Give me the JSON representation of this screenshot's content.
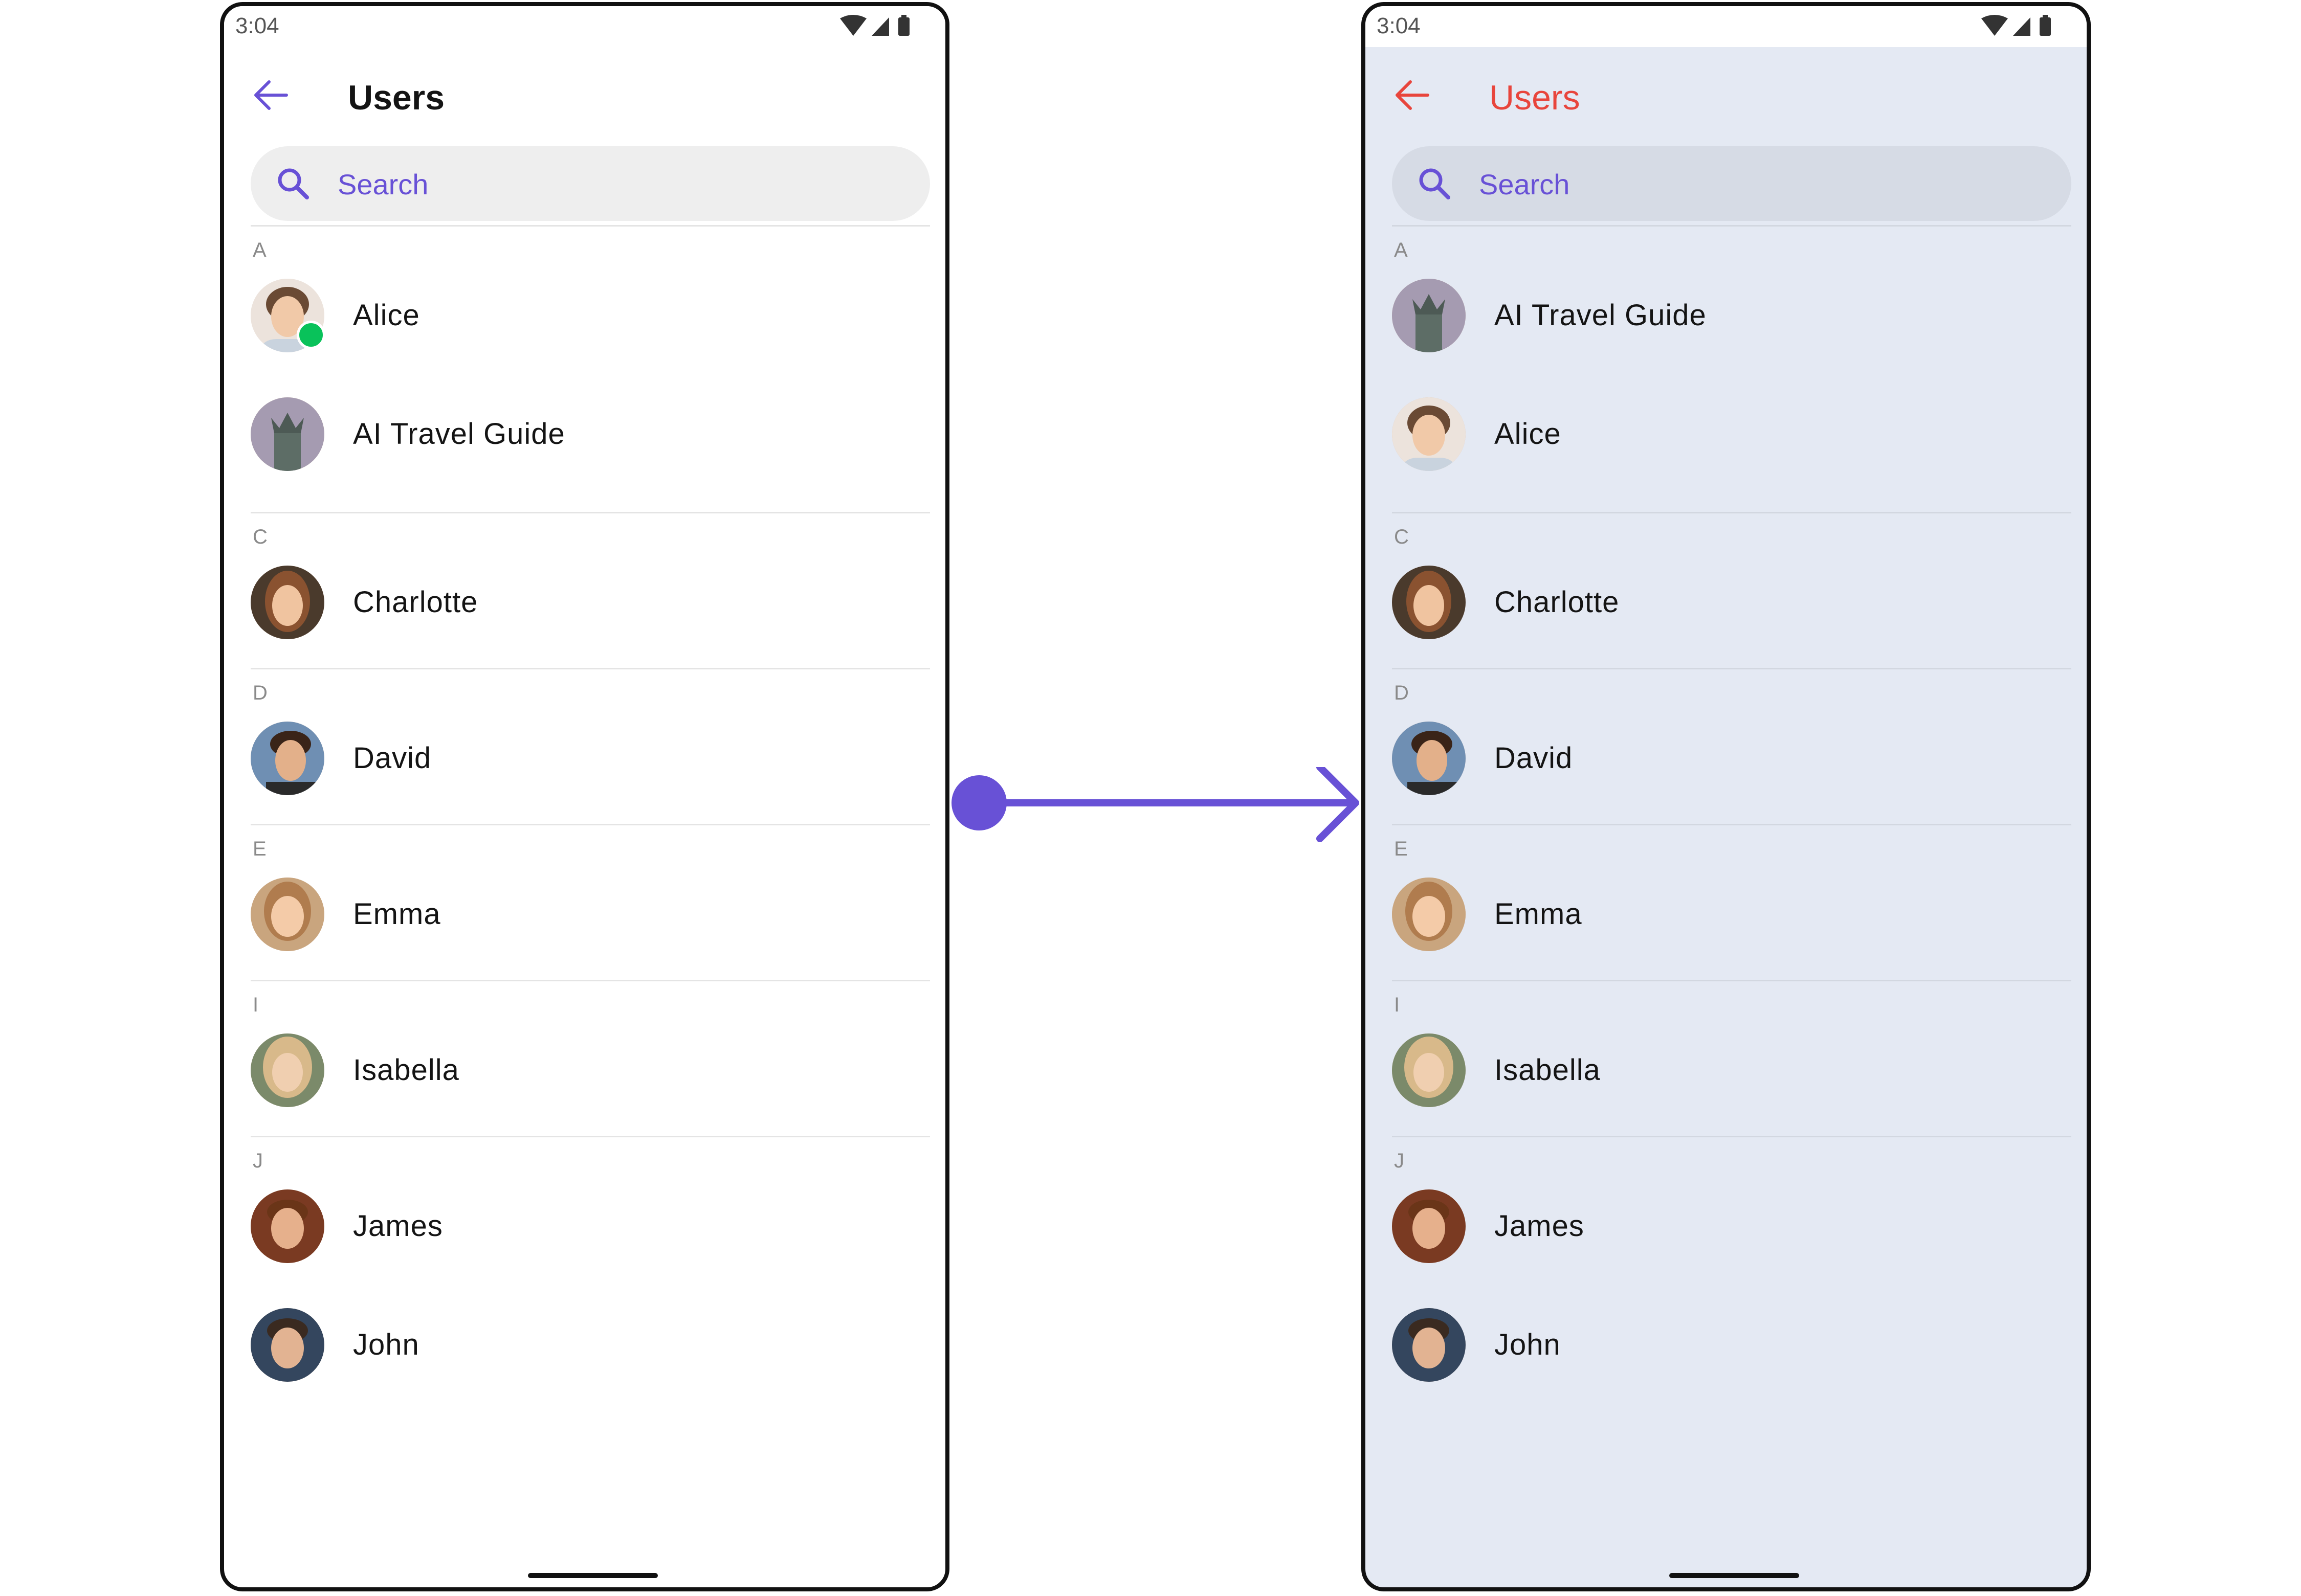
{
  "colors": {
    "accent": "#6851d6",
    "online": "#09c25a",
    "custom_title": "#e8453c",
    "custom_background": "#e4e9f3"
  },
  "icons": {
    "back": "arrow-left-icon",
    "search": "search-icon",
    "status": [
      "wifi-icon",
      "cellular-signal-icon",
      "battery-icon"
    ],
    "transition": "arrow-right-icon"
  },
  "left": {
    "status_time": "3:04",
    "title": "Users",
    "search_placeholder": "Search",
    "sections": [
      {
        "letter": "A",
        "users": [
          {
            "name": "Alice",
            "online": true
          },
          {
            "name": "AI Travel Guide",
            "online": false
          }
        ]
      },
      {
        "letter": "C",
        "users": [
          {
            "name": "Charlotte",
            "online": false
          }
        ]
      },
      {
        "letter": "D",
        "users": [
          {
            "name": "David",
            "online": false
          }
        ]
      },
      {
        "letter": "E",
        "users": [
          {
            "name": "Emma",
            "online": false
          }
        ]
      },
      {
        "letter": "I",
        "users": [
          {
            "name": "Isabella",
            "online": false
          }
        ]
      },
      {
        "letter": "J",
        "users": [
          {
            "name": "James",
            "online": false
          },
          {
            "name": "John",
            "online": false
          }
        ]
      }
    ]
  },
  "right": {
    "status_time": "3:04",
    "title": "Users",
    "search_placeholder": "Search",
    "sections": [
      {
        "letter": "A",
        "users": [
          {
            "name": "AI Travel Guide",
            "online": false
          },
          {
            "name": "Alice",
            "online": false
          }
        ]
      },
      {
        "letter": "C",
        "users": [
          {
            "name": "Charlotte",
            "online": false
          }
        ]
      },
      {
        "letter": "D",
        "users": [
          {
            "name": "David",
            "online": false
          }
        ]
      },
      {
        "letter": "E",
        "users": [
          {
            "name": "Emma",
            "online": false
          }
        ]
      },
      {
        "letter": "I",
        "users": [
          {
            "name": "Isabella",
            "online": false
          }
        ]
      },
      {
        "letter": "J",
        "users": [
          {
            "name": "James",
            "online": false
          },
          {
            "name": "John",
            "online": false
          }
        ]
      }
    ]
  }
}
